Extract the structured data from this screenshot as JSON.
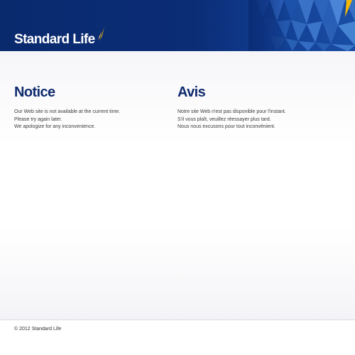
{
  "header": {
    "logo_text": "Standard Life",
    "brand_color": "#0b2d76",
    "accent_color": "#f5b800"
  },
  "notice_en": {
    "title": "Notice",
    "lines": [
      "Our Web site is not available at the current time.",
      "Please try again later.",
      "We apologize for any inconvenience."
    ]
  },
  "notice_fr": {
    "title": "Avis",
    "lines": [
      "Notre site Web n'est pas disponible pour l'instant.",
      "S'il vous plaît, veuillez réessayer plus tard.",
      "Nous nous excusons pour tout inconvénient."
    ]
  },
  "footer": {
    "copyright": "© 2012 Standard Life"
  }
}
